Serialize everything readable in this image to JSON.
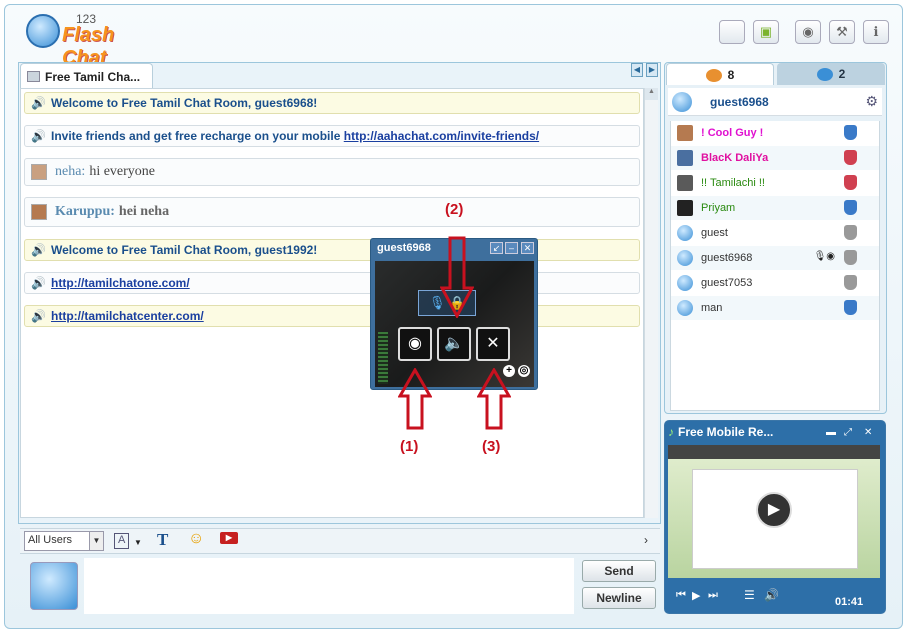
{
  "app": {
    "logo_number": "123",
    "logo_text": "Flash Chat"
  },
  "top_buttons": [
    "apple-icon",
    "android-icon",
    "webcam-icon",
    "wrench-icon",
    "info-icon"
  ],
  "chat": {
    "tab_label": "Free Tamil Cha...",
    "messages": [
      {
        "type": "system",
        "text": "Welcome to Free Tamil Chat Room, guest6968!"
      },
      {
        "type": "system",
        "text": "Invite friends and get free recharge on your mobile ",
        "link": "http://aahachat.com/invite-friends/"
      },
      {
        "type": "user",
        "name": "neha:",
        "text": "hi everyone"
      },
      {
        "type": "user",
        "name": "Karuppu:",
        "text": "hei neha"
      },
      {
        "type": "system",
        "text": "Welcome to Free Tamil Chat Room, guest1992!"
      },
      {
        "type": "link",
        "link": "http://tamilchatone.com/"
      },
      {
        "type": "link",
        "link": "http://tamilchatcenter.com/"
      }
    ],
    "recipient_select": "All Users",
    "send_label": "Send",
    "newline_label": "Newline"
  },
  "right_panel": {
    "tab_users_count": "8",
    "tab_rooms_count": "2",
    "current_user": "guest6968",
    "users": [
      {
        "name": "! Cool Guy !",
        "color": "#e010d0",
        "bold": true,
        "gender": "male"
      },
      {
        "name": "BlacK DaliYa",
        "color": "#e010a0",
        "bold": true,
        "gender": "female"
      },
      {
        "name": "!! Tamilachi !!",
        "color": "#2a8a10",
        "bold": false,
        "gender": "female"
      },
      {
        "name": "Priyam",
        "color": "#2a8a10",
        "bold": false,
        "gender": "male"
      },
      {
        "name": "guest",
        "color": "#333333",
        "bold": false,
        "gender": "unknown"
      },
      {
        "name": "guest6968",
        "color": "#333333",
        "bold": false,
        "gender": "unknown"
      },
      {
        "name": "guest7053",
        "color": "#333333",
        "bold": false,
        "gender": "unknown"
      },
      {
        "name": "man",
        "color": "#333333",
        "bold": false,
        "gender": "male"
      }
    ]
  },
  "video": {
    "title": "Free Mobile Re...",
    "time": "01:41"
  },
  "cam_popup": {
    "title": "guest6968"
  },
  "annotations": {
    "label1": "(1)",
    "label2": "(2)",
    "label3": "(3)"
  },
  "colors": {
    "accent": "#2d6fa8",
    "annotation": "#c8111f",
    "system_text": "#1a4f8c"
  }
}
